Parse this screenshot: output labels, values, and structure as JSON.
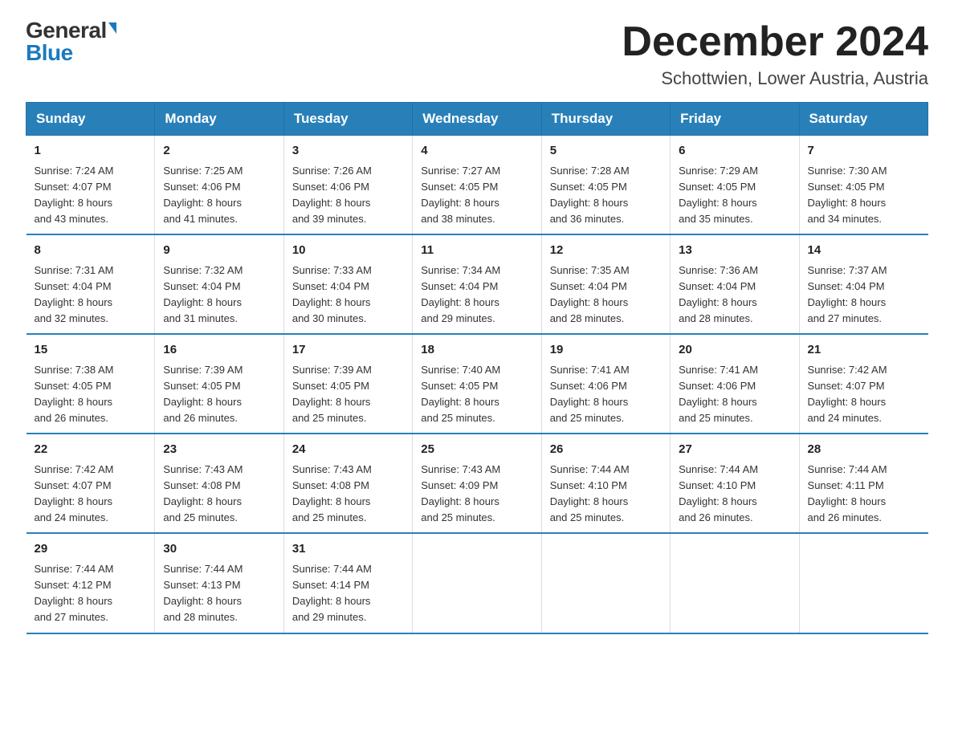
{
  "logo": {
    "general": "General",
    "blue": "Blue"
  },
  "header": {
    "month": "December 2024",
    "location": "Schottwien, Lower Austria, Austria"
  },
  "weekdays": [
    "Sunday",
    "Monday",
    "Tuesday",
    "Wednesday",
    "Thursday",
    "Friday",
    "Saturday"
  ],
  "weeks": [
    [
      {
        "day": "1",
        "sunrise": "7:24 AM",
        "sunset": "4:07 PM",
        "daylight": "8 hours and 43 minutes."
      },
      {
        "day": "2",
        "sunrise": "7:25 AM",
        "sunset": "4:06 PM",
        "daylight": "8 hours and 41 minutes."
      },
      {
        "day": "3",
        "sunrise": "7:26 AM",
        "sunset": "4:06 PM",
        "daylight": "8 hours and 39 minutes."
      },
      {
        "day": "4",
        "sunrise": "7:27 AM",
        "sunset": "4:05 PM",
        "daylight": "8 hours and 38 minutes."
      },
      {
        "day": "5",
        "sunrise": "7:28 AM",
        "sunset": "4:05 PM",
        "daylight": "8 hours and 36 minutes."
      },
      {
        "day": "6",
        "sunrise": "7:29 AM",
        "sunset": "4:05 PM",
        "daylight": "8 hours and 35 minutes."
      },
      {
        "day": "7",
        "sunrise": "7:30 AM",
        "sunset": "4:05 PM",
        "daylight": "8 hours and 34 minutes."
      }
    ],
    [
      {
        "day": "8",
        "sunrise": "7:31 AM",
        "sunset": "4:04 PM",
        "daylight": "8 hours and 32 minutes."
      },
      {
        "day": "9",
        "sunrise": "7:32 AM",
        "sunset": "4:04 PM",
        "daylight": "8 hours and 31 minutes."
      },
      {
        "day": "10",
        "sunrise": "7:33 AM",
        "sunset": "4:04 PM",
        "daylight": "8 hours and 30 minutes."
      },
      {
        "day": "11",
        "sunrise": "7:34 AM",
        "sunset": "4:04 PM",
        "daylight": "8 hours and 29 minutes."
      },
      {
        "day": "12",
        "sunrise": "7:35 AM",
        "sunset": "4:04 PM",
        "daylight": "8 hours and 28 minutes."
      },
      {
        "day": "13",
        "sunrise": "7:36 AM",
        "sunset": "4:04 PM",
        "daylight": "8 hours and 28 minutes."
      },
      {
        "day": "14",
        "sunrise": "7:37 AM",
        "sunset": "4:04 PM",
        "daylight": "8 hours and 27 minutes."
      }
    ],
    [
      {
        "day": "15",
        "sunrise": "7:38 AM",
        "sunset": "4:05 PM",
        "daylight": "8 hours and 26 minutes."
      },
      {
        "day": "16",
        "sunrise": "7:39 AM",
        "sunset": "4:05 PM",
        "daylight": "8 hours and 26 minutes."
      },
      {
        "day": "17",
        "sunrise": "7:39 AM",
        "sunset": "4:05 PM",
        "daylight": "8 hours and 25 minutes."
      },
      {
        "day": "18",
        "sunrise": "7:40 AM",
        "sunset": "4:05 PM",
        "daylight": "8 hours and 25 minutes."
      },
      {
        "day": "19",
        "sunrise": "7:41 AM",
        "sunset": "4:06 PM",
        "daylight": "8 hours and 25 minutes."
      },
      {
        "day": "20",
        "sunrise": "7:41 AM",
        "sunset": "4:06 PM",
        "daylight": "8 hours and 25 minutes."
      },
      {
        "day": "21",
        "sunrise": "7:42 AM",
        "sunset": "4:07 PM",
        "daylight": "8 hours and 24 minutes."
      }
    ],
    [
      {
        "day": "22",
        "sunrise": "7:42 AM",
        "sunset": "4:07 PM",
        "daylight": "8 hours and 24 minutes."
      },
      {
        "day": "23",
        "sunrise": "7:43 AM",
        "sunset": "4:08 PM",
        "daylight": "8 hours and 25 minutes."
      },
      {
        "day": "24",
        "sunrise": "7:43 AM",
        "sunset": "4:08 PM",
        "daylight": "8 hours and 25 minutes."
      },
      {
        "day": "25",
        "sunrise": "7:43 AM",
        "sunset": "4:09 PM",
        "daylight": "8 hours and 25 minutes."
      },
      {
        "day": "26",
        "sunrise": "7:44 AM",
        "sunset": "4:10 PM",
        "daylight": "8 hours and 25 minutes."
      },
      {
        "day": "27",
        "sunrise": "7:44 AM",
        "sunset": "4:10 PM",
        "daylight": "8 hours and 26 minutes."
      },
      {
        "day": "28",
        "sunrise": "7:44 AM",
        "sunset": "4:11 PM",
        "daylight": "8 hours and 26 minutes."
      }
    ],
    [
      {
        "day": "29",
        "sunrise": "7:44 AM",
        "sunset": "4:12 PM",
        "daylight": "8 hours and 27 minutes."
      },
      {
        "day": "30",
        "sunrise": "7:44 AM",
        "sunset": "4:13 PM",
        "daylight": "8 hours and 28 minutes."
      },
      {
        "day": "31",
        "sunrise": "7:44 AM",
        "sunset": "4:14 PM",
        "daylight": "8 hours and 29 minutes."
      },
      null,
      null,
      null,
      null
    ]
  ],
  "labels": {
    "sunrise": "Sunrise:",
    "sunset": "Sunset:",
    "daylight": "Daylight:"
  }
}
